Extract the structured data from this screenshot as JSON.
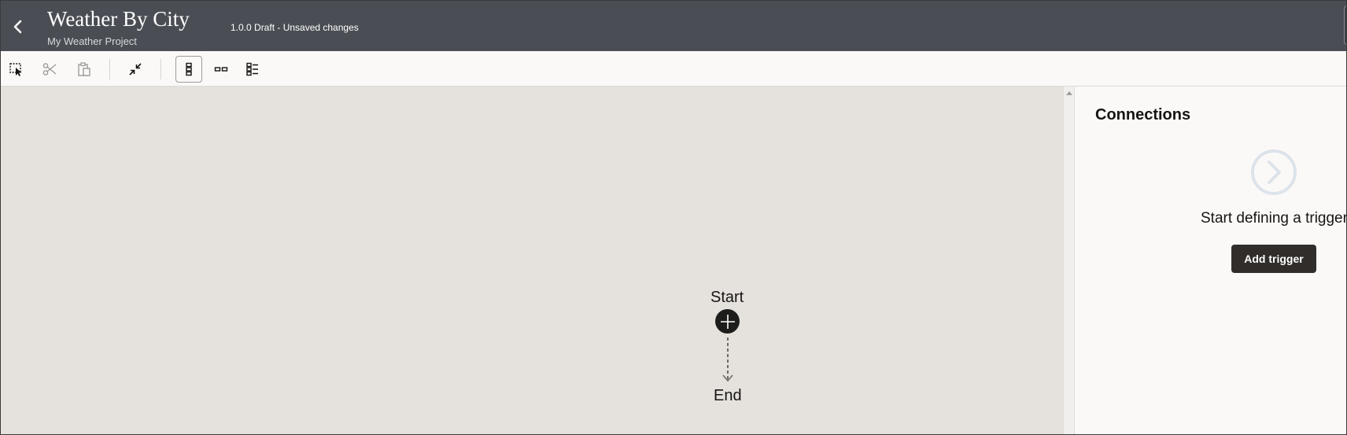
{
  "header": {
    "title": "Weather By City",
    "subtitle": "My Weather Project",
    "status": "1.0.0 Draft - Unsaved changes",
    "back_icon": "chevron-left-icon"
  },
  "toolbar": {
    "tools": [
      {
        "name": "select-icon",
        "state": "enabled"
      },
      {
        "name": "cut-icon",
        "state": "disabled"
      },
      {
        "name": "paste-icon",
        "state": "disabled"
      },
      {
        "name": "collapse-icon",
        "state": "enabled"
      },
      {
        "name": "vertical-layout-icon",
        "state": "selected"
      },
      {
        "name": "horizontal-layout-icon",
        "state": "enabled"
      },
      {
        "name": "pseudo-view-icon",
        "state": "enabled"
      }
    ]
  },
  "canvas": {
    "start_label": "Start",
    "end_label": "End",
    "start_icon": "plus-icon"
  },
  "panel": {
    "title": "Connections",
    "empty_message": "Start defining a trigger",
    "add_trigger_label": "Add trigger",
    "empty_icon": "chevron-right-circle-icon"
  },
  "colors": {
    "header_bg": "#4a4e54",
    "canvas_bg": "#e5e1dc",
    "panel_bg": "#fbf9f8",
    "button_bg": "#312d2a",
    "node_bg": "#1d1d1b"
  }
}
